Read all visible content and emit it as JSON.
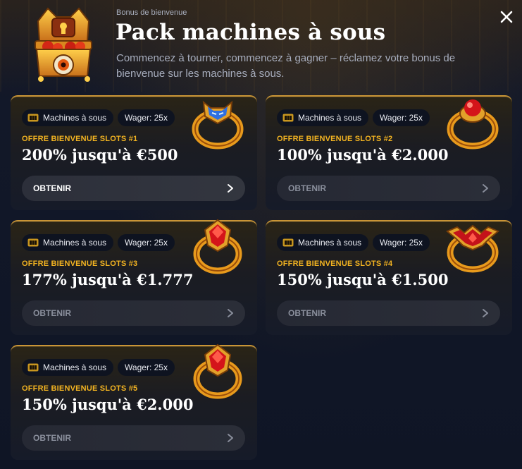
{
  "header": {
    "eyebrow": "Bonus de bienvenue",
    "title": "Pack machines à sous",
    "subtitle": "Commencez à tourner, commencez à gagner – réclamez votre bonus de bienvenue sur les machines à sous."
  },
  "icons": {
    "close": "close-icon",
    "chest": "treasure-chest-icon",
    "slot": "slot-machine-icon",
    "chevron": "chevron-right-icon"
  },
  "colors": {
    "accent": "#f2b321",
    "card_border": "#c99536",
    "background": "#0f1525"
  },
  "offers": [
    {
      "tag_game": "Machines à sous",
      "tag_wager": "Wager: 25x",
      "label": "OFFRE BIENVENUE SLOTS #1",
      "amount": "200% jusqu'à €500",
      "cta": "OBTENIR",
      "gem": "blue-demon-ring-icon"
    },
    {
      "tag_game": "Machines à sous",
      "tag_wager": "Wager: 25x",
      "label": "OFFRE BIENVENUE SLOTS #2",
      "amount": "100% jusqu'à €2.000",
      "cta": "OBTENIR",
      "gem": "red-orb-ring-icon"
    },
    {
      "tag_game": "Machines à sous",
      "tag_wager": "Wager: 25x",
      "label": "OFFRE BIENVENUE SLOTS #3",
      "amount": "177% jusqu'à €1.777",
      "cta": "OBTENIR",
      "gem": "red-gem-ring-icon"
    },
    {
      "tag_game": "Machines à sous",
      "tag_wager": "Wager: 25x",
      "label": "OFFRE BIENVENUE SLOTS #4",
      "amount": "150% jusqu'à €1.500",
      "cta": "OBTENIR",
      "gem": "red-bat-ring-icon"
    },
    {
      "tag_game": "Machines à sous",
      "tag_wager": "Wager: 25x",
      "label": "OFFRE BIENVENUE SLOTS #5",
      "amount": "150% jusqu'à €2.000",
      "cta": "OBTENIR",
      "gem": "red-gem-ring-icon"
    }
  ]
}
